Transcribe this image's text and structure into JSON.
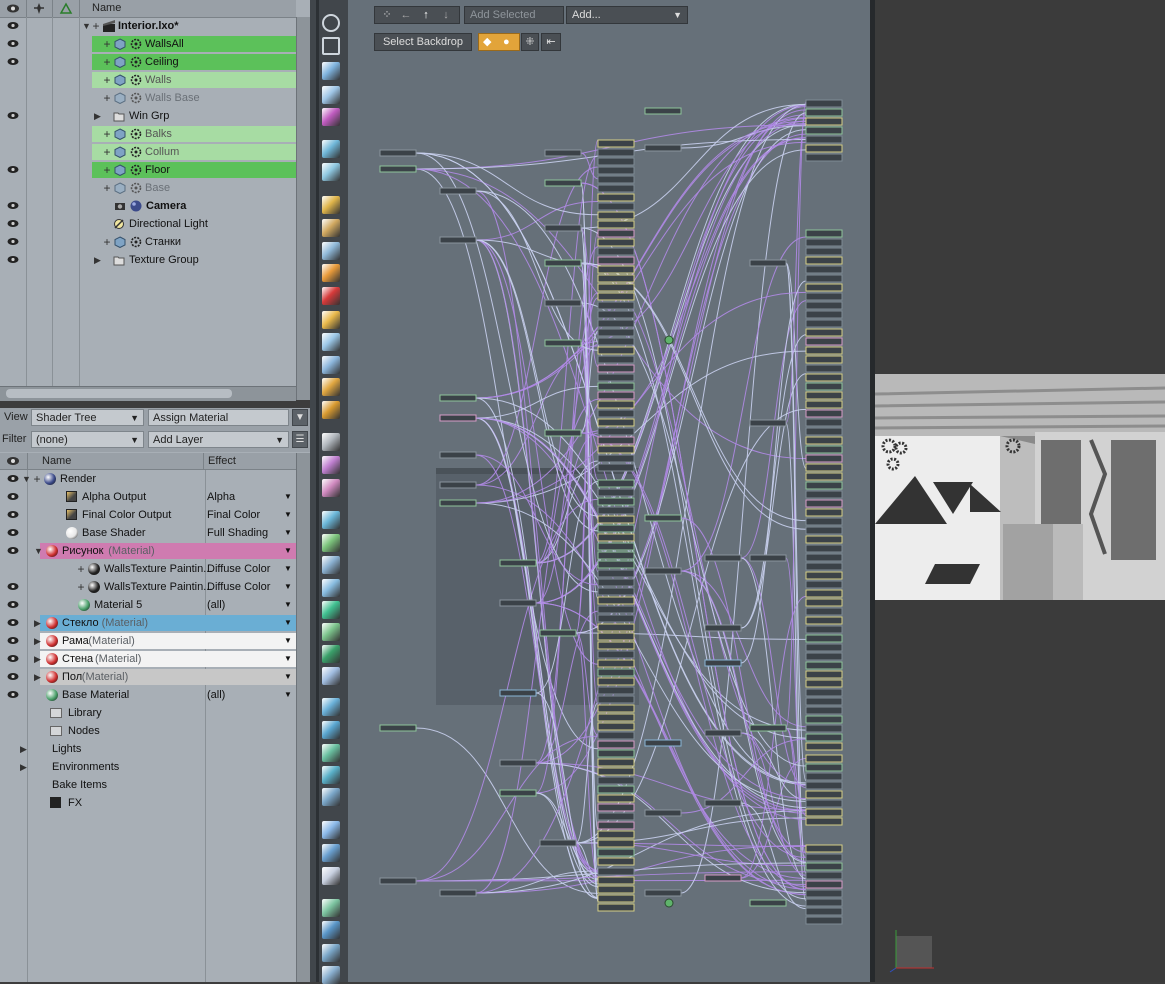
{
  "items_list": {
    "header_name": "Name",
    "rows": [
      {
        "label": "Interior.lxo*",
        "bold": true
      },
      {
        "label": "WallsAll"
      },
      {
        "label": "Ceiling"
      },
      {
        "label": "Walls"
      },
      {
        "label": "Walls Base"
      },
      {
        "label": "Win Grp"
      },
      {
        "label": "Balks"
      },
      {
        "label": "Collum"
      },
      {
        "label": "Floor"
      },
      {
        "label": "Base"
      },
      {
        "label": "Camera",
        "bold": true
      },
      {
        "label": "Directional Light"
      },
      {
        "label": "Станки"
      },
      {
        "label": "Texture Group"
      }
    ]
  },
  "shader_toolbar": {
    "view_label": "View",
    "view_value": "Shader Tree",
    "assign_material": "Assign Material",
    "filter_label": "Filter",
    "filter_value": "(none)",
    "add_layer": "Add Layer"
  },
  "shader_tree": {
    "col_name": "Name",
    "col_effect": "Effect",
    "rows": [
      {
        "label": "Render",
        "effect": ""
      },
      {
        "label": "Alpha Output",
        "effect": "Alpha"
      },
      {
        "label": "Final Color Output",
        "effect": "Final Color"
      },
      {
        "label": "Base Shader",
        "effect": "Full Shading"
      },
      {
        "label": "Рисунок",
        "suffix": " (Material)",
        "effect": ""
      },
      {
        "label": "WallsTexture Paintin...",
        "effect": "Diffuse Color"
      },
      {
        "label": "WallsTexture Paintin...",
        "effect": "Diffuse Color"
      },
      {
        "label": "Material 5",
        "effect": "(all)"
      },
      {
        "label": "Стекло",
        "suffix": " (Material)",
        "effect": ""
      },
      {
        "label": "Рама",
        "suffix": " (Material)",
        "effect": ""
      },
      {
        "label": "Стена",
        "suffix": " (Material)",
        "effect": ""
      },
      {
        "label": "Пол",
        "suffix": " (Material)",
        "effect": ""
      },
      {
        "label": "Base Material",
        "effect": "(all)"
      },
      {
        "label": "Library",
        "effect": ""
      },
      {
        "label": "Nodes",
        "effect": ""
      },
      {
        "label": "Lights",
        "effect": ""
      },
      {
        "label": "Environments",
        "effect": ""
      },
      {
        "label": "Bake Items",
        "effect": ""
      },
      {
        "label": "FX",
        "effect": ""
      }
    ]
  },
  "graph_toolbar": {
    "add_selected": "Add Selected",
    "add": "Add...",
    "select_backdrop": "Select Backdrop"
  },
  "colors": {
    "panel_bg": "#a8afb6",
    "graph_bg": "#667079",
    "highlight_strong": "#5cc15a",
    "highlight_light": "#a7dca3",
    "material_pink": "#cf7bb0",
    "material_blue": "#6aaed4",
    "wire_purple": "#b08ae6",
    "wire_light": "#c9d0ee"
  }
}
